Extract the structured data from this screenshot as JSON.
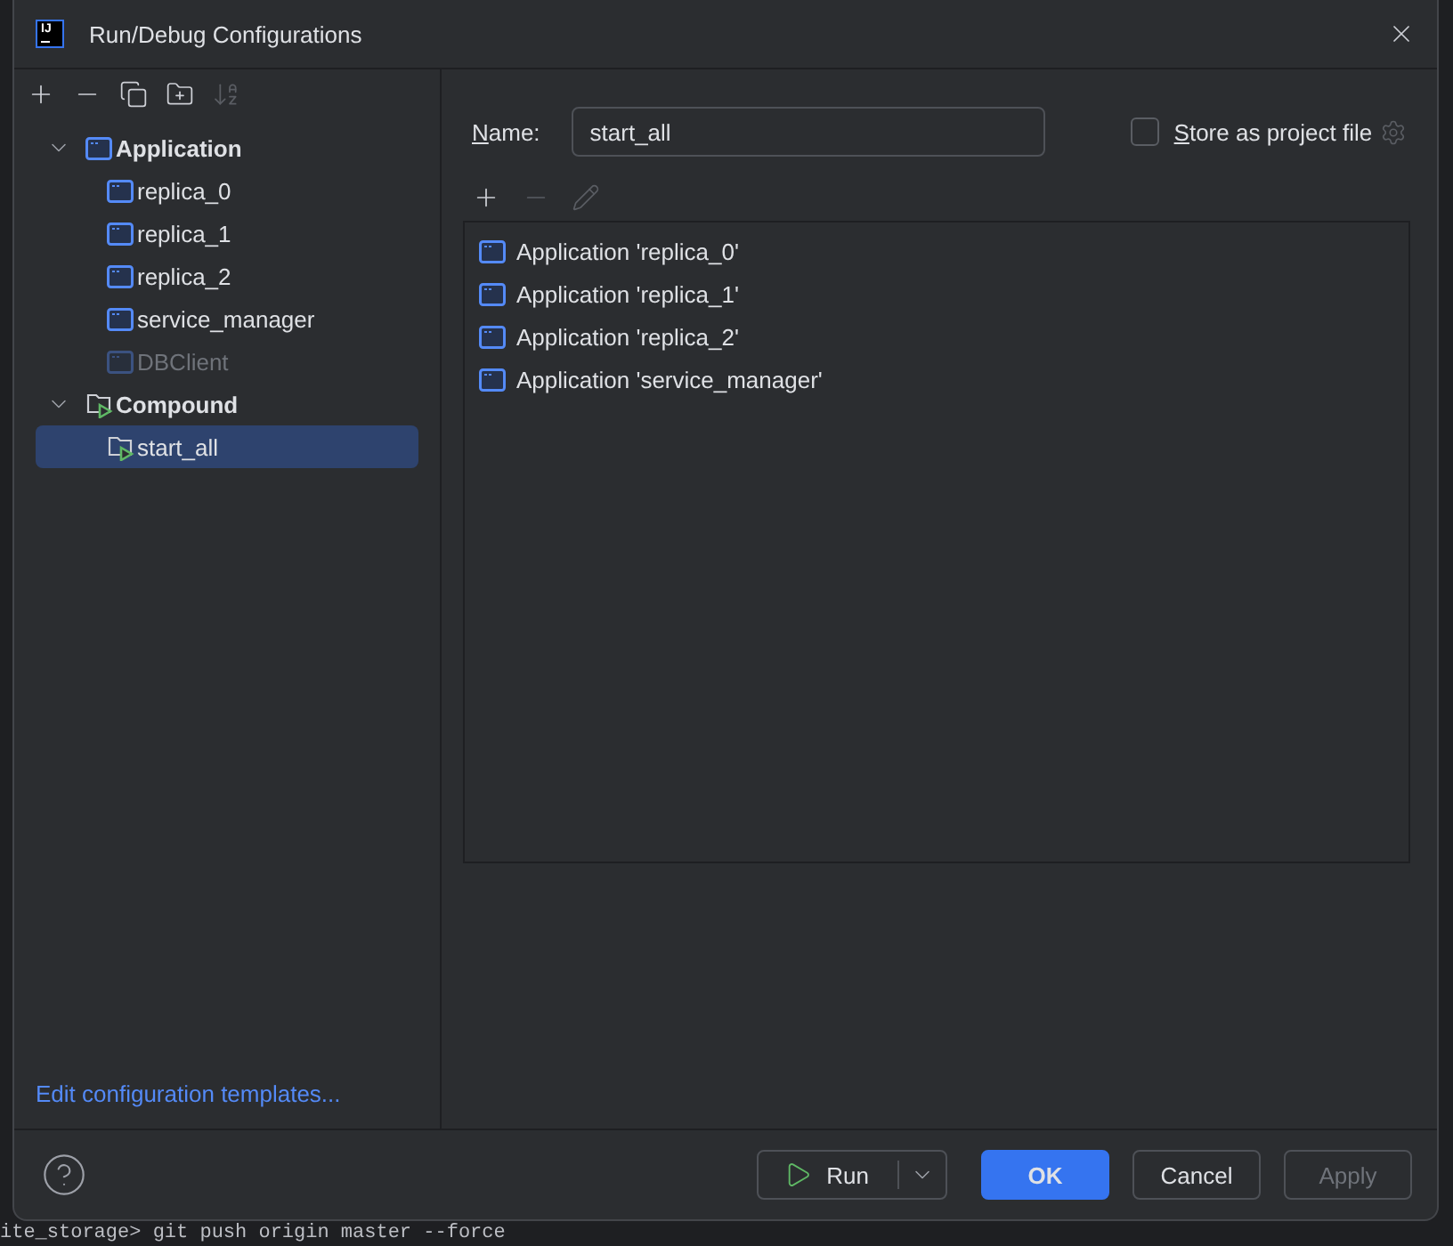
{
  "background": {
    "terminal_line": "ite_storage> git push origin master --force"
  },
  "window": {
    "logo_text": "IJ",
    "title": "Run/Debug Configurations"
  },
  "sidebar": {
    "toolbar": [
      {
        "kind": "add",
        "disabled": false
      },
      {
        "kind": "remove",
        "disabled": false
      },
      {
        "kind": "copy",
        "disabled": false
      },
      {
        "kind": "new-folder",
        "disabled": false
      },
      {
        "kind": "sort",
        "disabled": true
      }
    ],
    "tree": [
      {
        "label": "Application",
        "kind": "application",
        "expanded": true,
        "selected": false,
        "children": [
          {
            "label": "replica_0",
            "kind": "application",
            "selected": false,
            "disabled": false
          },
          {
            "label": "replica_1",
            "kind": "application",
            "selected": false,
            "disabled": false
          },
          {
            "label": "replica_2",
            "kind": "application",
            "selected": false,
            "disabled": false
          },
          {
            "label": "service_manager",
            "kind": "application",
            "selected": false,
            "disabled": false
          },
          {
            "label": "DBClient",
            "kind": "application",
            "selected": false,
            "disabled": true
          }
        ]
      },
      {
        "label": "Compound",
        "kind": "compound",
        "expanded": true,
        "selected": false,
        "children": [
          {
            "label": "start_all",
            "kind": "compound",
            "selected": true,
            "disabled": false
          }
        ]
      }
    ],
    "templates_link": "Edit configuration templates..."
  },
  "form": {
    "name_label": "Name:",
    "name_value": "start_all",
    "store_label": "Store as project file",
    "store_checked": false,
    "toolbar": [
      {
        "kind": "add",
        "disabled": false
      },
      {
        "kind": "remove",
        "disabled": true
      },
      {
        "kind": "edit",
        "disabled": true
      }
    ],
    "configurations": [
      {
        "label": "Application 'replica_0'",
        "kind": "application"
      },
      {
        "label": "Application 'replica_1'",
        "kind": "application"
      },
      {
        "label": "Application 'replica_2'",
        "kind": "application"
      },
      {
        "label": "Application 'service_manager'",
        "kind": "application"
      }
    ]
  },
  "footer": {
    "run": "Run",
    "ok": "OK",
    "cancel": "Cancel",
    "apply": "Apply",
    "apply_disabled": true
  }
}
